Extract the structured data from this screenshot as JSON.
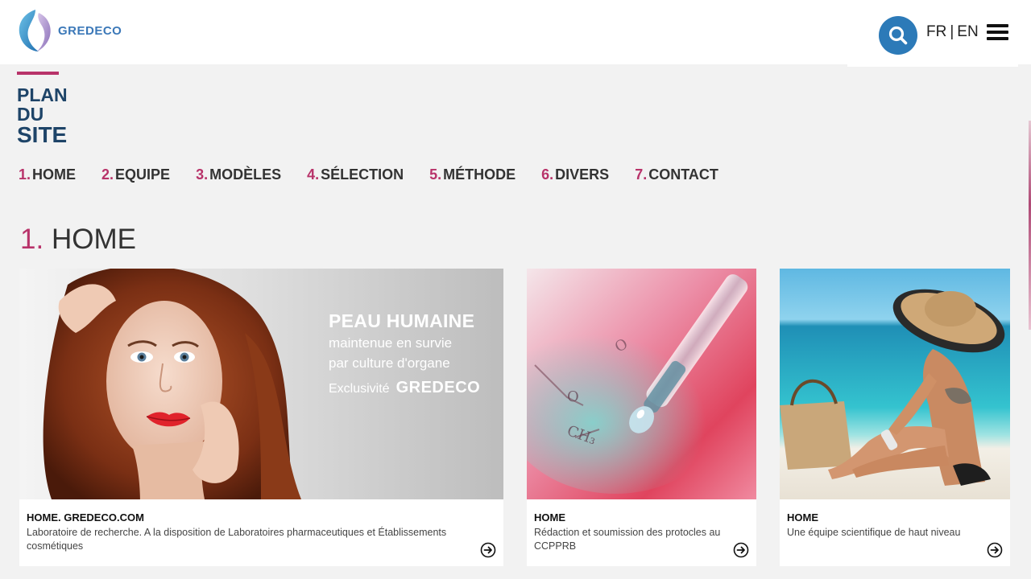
{
  "header": {
    "logo_text": "GREDECO",
    "lang_fr": "FR",
    "lang_sep": "|",
    "lang_en": "EN",
    "search_icon": "search-icon",
    "menu_icon": "hamburger-icon"
  },
  "page_title": {
    "line1": "PLAN",
    "line2": "DU",
    "line3": "SITE"
  },
  "nav": {
    "items": [
      {
        "num": "1.",
        "label": "HOME"
      },
      {
        "num": "2.",
        "label": "EQUIPE"
      },
      {
        "num": "3.",
        "label": "MODÈLES"
      },
      {
        "num": "4.",
        "label": "SÉLECTION"
      },
      {
        "num": "5.",
        "label": "MÉTHODE"
      },
      {
        "num": "6.",
        "label": "DIVERS"
      },
      {
        "num": "7.",
        "label": "CONTACT"
      }
    ]
  },
  "section": {
    "num": "1.",
    "title": "HOME"
  },
  "cards": [
    {
      "title": "HOME. GREDECO.COM",
      "desc": "Laboratoire de recherche. A la disposition de Laboratoires pharmaceutiques et Établissements cosmétiques",
      "banner": {
        "title": "PEAU HUMAINE",
        "line1": "maintenue en survie",
        "line2": "par culture d'organe",
        "excl": "Exclusivité",
        "brand": "GREDECO"
      }
    },
    {
      "title": "HOME",
      "desc": "Rédaction et soumission des protocles au CCPPRB"
    },
    {
      "title": "HOME",
      "desc": "Une équipe scientifique de haut niveau"
    }
  ],
  "colors": {
    "accent": "#b8336a",
    "title_blue": "#1e4468",
    "search_blue": "#2c7ab8",
    "background": "#f2f2f2"
  }
}
